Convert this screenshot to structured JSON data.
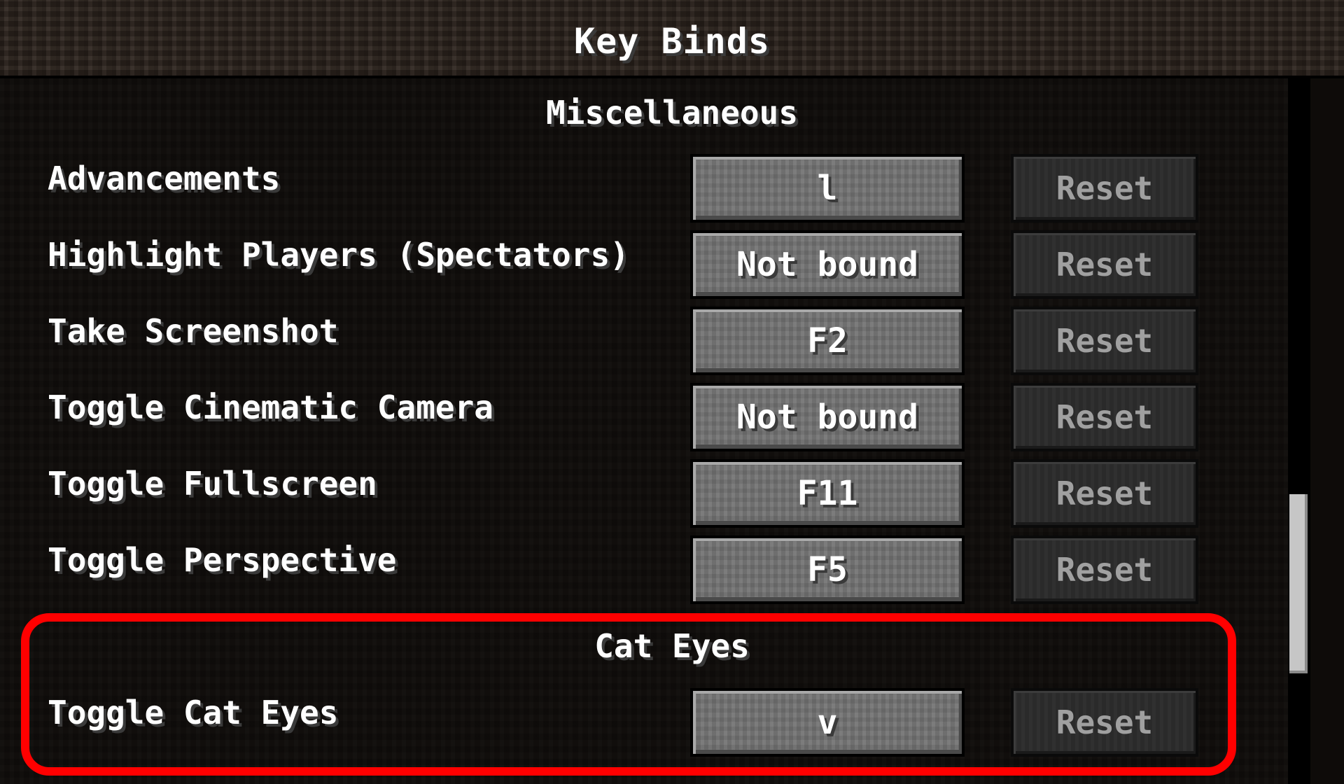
{
  "title": "Key Binds",
  "categories": [
    {
      "name": "Miscellaneous",
      "rows": [
        {
          "label": "Advancements",
          "key": "l",
          "reset": "Reset"
        },
        {
          "label": "Highlight Players (Spectators)",
          "key": "Not bound",
          "reset": "Reset"
        },
        {
          "label": "Take Screenshot",
          "key": "F2",
          "reset": "Reset"
        },
        {
          "label": "Toggle Cinematic Camera",
          "key": "Not bound",
          "reset": "Reset"
        },
        {
          "label": "Toggle Fullscreen",
          "key": "F11",
          "reset": "Reset"
        },
        {
          "label": "Toggle Perspective",
          "key": "F5",
          "reset": "Reset"
        }
      ]
    },
    {
      "name": "Cat Eyes",
      "rows": [
        {
          "label": "Toggle Cat Eyes",
          "key": "v",
          "reset": "Reset"
        }
      ]
    }
  ],
  "highlight_color": "#ff0000",
  "scrollbar": {
    "position_fraction": 0.58
  }
}
